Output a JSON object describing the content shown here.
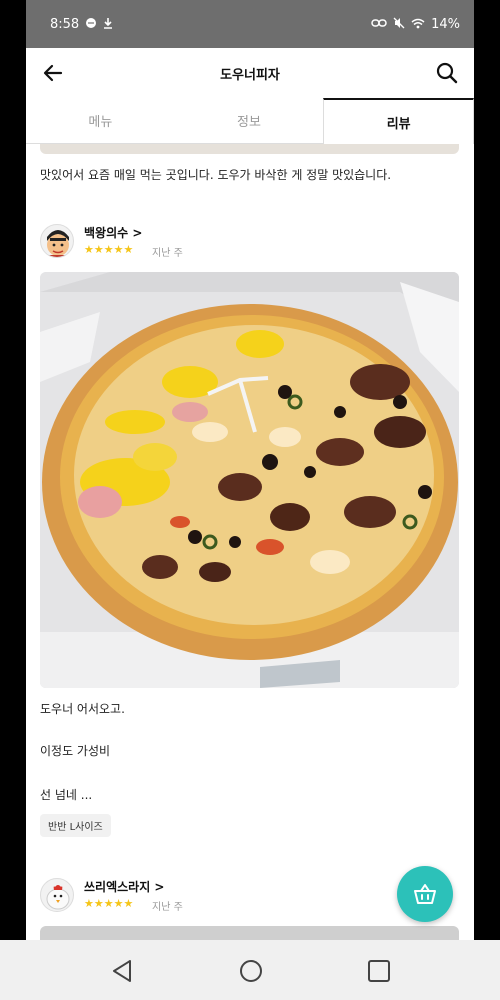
{
  "status": {
    "time": "8:58",
    "battery": "14%"
  },
  "header": {
    "title": "도우너피자"
  },
  "tabs": [
    {
      "label": "메뉴",
      "active": false
    },
    {
      "label": "정보",
      "active": false
    },
    {
      "label": "리뷰",
      "active": true
    }
  ],
  "reviews": {
    "previous_text": "맛있어서 요즘 매일 먹는 곳입니다. 도우가 바삭한 게 정말 맛있습니다.",
    "current": {
      "name": "백왕의수 >",
      "stars": "★★★★★",
      "rating": 5,
      "time": "지난 주",
      "body": [
        "도우너 어서오고.",
        "이정도 가성비",
        "선 넘네 ..."
      ],
      "tag": "반반 L사이즈"
    },
    "next": {
      "name": "쓰리엑스라지 >",
      "stars": "★★★★★",
      "rating": 5,
      "time": "지난 주"
    }
  },
  "icons": {
    "back": "arrow-left-icon",
    "search": "search-icon",
    "cart": "basket-icon"
  },
  "colors": {
    "accent": "#2cc1b9",
    "star": "#f5c518",
    "statusbar": "#6e6e6e"
  }
}
